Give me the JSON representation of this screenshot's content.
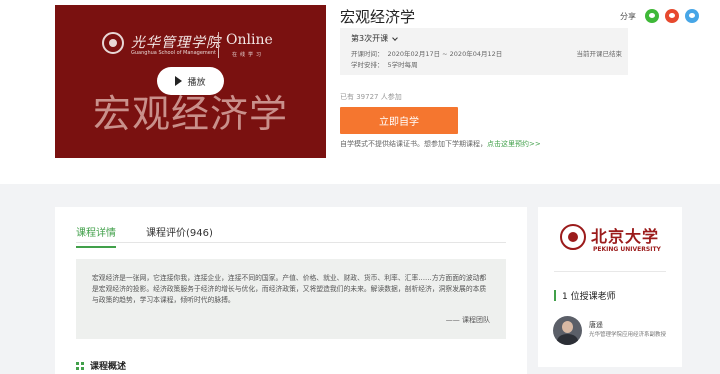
{
  "video": {
    "logo_cn": "光华管理学院",
    "logo_en": "Guanghua School of Management",
    "logo_online": "Online",
    "logo_online_sub": "在线学习",
    "play_label": "播放",
    "title_overlay": "宏观经济学",
    "bg_color": "#7a1110"
  },
  "course": {
    "title": "宏观经济学",
    "session_label": "第3次开课",
    "time_label": "开课时间：",
    "time_value": "2020年02月17日 ~ 2020年04月12日",
    "schedule_label": "学时安排：",
    "schedule_value": "5学时每周",
    "status": "当前开课已结束",
    "enrolled": "已有 39727 人参加",
    "enroll_button": "立即自学",
    "note": "自学模式不提供结课证书。想参加下学期课程，",
    "note_link": "点击这里预约>>",
    "accent": "#41a04a",
    "button_color": "#f5762f"
  },
  "share": {
    "label": "分享",
    "icons": [
      "wechat-icon",
      "weibo-icon",
      "qq-icon"
    ]
  },
  "tabs": [
    {
      "label": "课程详情",
      "active": true
    },
    {
      "label": "课程评价(946)",
      "active": false
    }
  ],
  "intro": {
    "text": "宏观经济是一张网，它连接你我，连接企业，连接不同的国家。产值、价格、就业、财政、货币、利率、汇率……方方面面的波动都是宏观经济的投影。经济政策服务于经济的增长与优化，而经济政策，又将塑造我们的未来。解读数据，剖析经济，洞察发展的本质与政策的趋势，学习本课程，倾听时代的脉搏。",
    "signature": "—— 课程团队"
  },
  "overview_title": "课程概述",
  "sidebar": {
    "school_cn": "北京大学",
    "school_en": "PEKING UNIVERSITY",
    "teachers_heading": "1 位授课老师",
    "teacher_name": "唐遥",
    "teacher_desc": "光华管理学院应用经济系副教授"
  }
}
